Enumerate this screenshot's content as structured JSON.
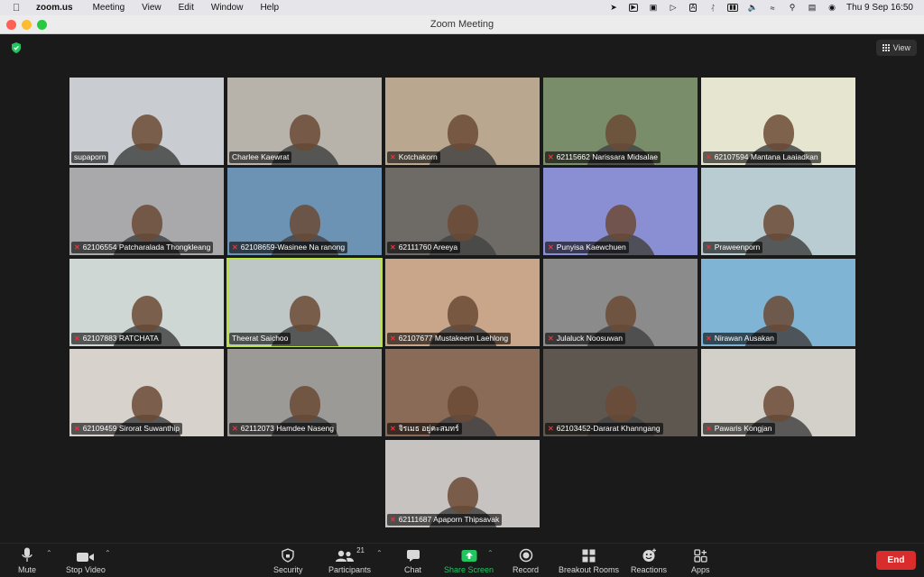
{
  "menubar": {
    "app": "zoom.us",
    "items": [
      "Meeting",
      "View",
      "Edit",
      "Window",
      "Help"
    ],
    "datetime": "Thu 9 Sep  16:50"
  },
  "window": {
    "title": "Zoom Meeting"
  },
  "view_button": {
    "label": "View"
  },
  "colors": {
    "end": "#d92d2d",
    "share": "#22c55e",
    "active_speaker": "#b9e33e",
    "mic_off": "#e5353d"
  },
  "participants": [
    {
      "name": "supaporn",
      "muted": false,
      "bg": "#c9ccd1"
    },
    {
      "name": "Charlee Kaewrat",
      "muted": false,
      "bg": "#b7b3ab"
    },
    {
      "name": "Kotchakorn",
      "muted": true,
      "bg": "#b9a78f"
    },
    {
      "name": "62115662 Narissara Midsalae",
      "muted": true,
      "bg": "#7a8d6a"
    },
    {
      "name": "62107594 Mantana Laaiadkan",
      "muted": true,
      "bg": "#e6e6d0"
    },
    {
      "name": "62106554 Patcharalada Thongkleang",
      "muted": true,
      "bg": "#a9a9ab"
    },
    {
      "name": "62108659-Wasinee Na ranong",
      "muted": true,
      "bg": "#6d93b4"
    },
    {
      "name": "62111760 Areeya",
      "muted": true,
      "bg": "#6e6a66"
    },
    {
      "name": "Punyisa Kaewchuen",
      "muted": true,
      "bg": "#8a8fd4"
    },
    {
      "name": "Praweenporn",
      "muted": true,
      "bg": "#b8ccd2"
    },
    {
      "name": "62107883 RATCHATA",
      "muted": true,
      "bg": "#cfd7d4"
    },
    {
      "name": "Theerat Saichoo",
      "muted": false,
      "bg": "#bfc7c6",
      "active": true
    },
    {
      "name": "62107677 Mustakeem Laehlong",
      "muted": true,
      "bg": "#c9a58a"
    },
    {
      "name": "Julaluck Noosuwan",
      "muted": true,
      "bg": "#8c8b8b"
    },
    {
      "name": "Nirawan Ausakan",
      "muted": true,
      "bg": "#7fb4d4"
    },
    {
      "name": "62109459 Sirorat Suwanthip",
      "muted": true,
      "bg": "#d8d2cc"
    },
    {
      "name": "62112073 Hamdee Naseng",
      "muted": true,
      "bg": "#9b9a97"
    },
    {
      "name": "จิรเมธ อยู่คะสมทร์",
      "muted": true,
      "bg": "#8a6b58"
    },
    {
      "name": "62103452-Dararat Khanngang",
      "muted": true,
      "bg": "#5d5750"
    },
    {
      "name": "Pawaris Kongjan",
      "muted": true,
      "bg": "#d3d0c9"
    },
    {
      "name": "62111687 Apaporn Thipsavak",
      "muted": true,
      "bg": "#c7c3c1"
    }
  ],
  "toolbar": {
    "mute": "Mute",
    "stop_video": "Stop Video",
    "security": "Security",
    "participants": "Participants",
    "participants_count": "21",
    "chat": "Chat",
    "share_screen": "Share Screen",
    "record": "Record",
    "breakout_rooms": "Breakout Rooms",
    "reactions": "Reactions",
    "apps": "Apps",
    "end": "End"
  }
}
